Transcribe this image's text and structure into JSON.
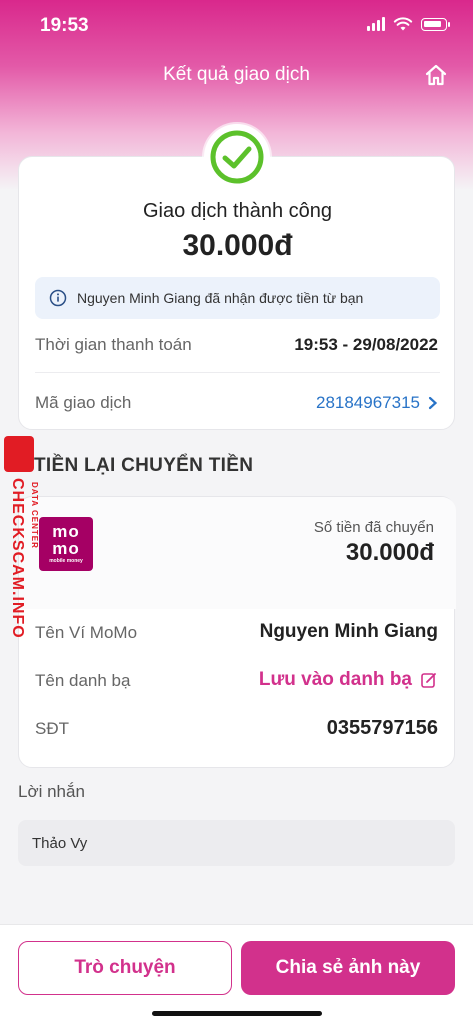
{
  "status_bar": {
    "time": "19:53"
  },
  "header": {
    "title": "Kết quả giao dịch"
  },
  "result": {
    "status": "Giao dịch thành công",
    "amount": "30.000đ",
    "info": "Nguyen Minh Giang đã nhận được tiền từ bạn",
    "rows": [
      {
        "label": "Thời gian thanh toán",
        "value": "19:53 - 29/08/2022"
      },
      {
        "label": "Mã giao dịch",
        "value": "28184967315"
      }
    ]
  },
  "transfer": {
    "section_title": "TIỀN LẠI CHUYỂN TIỀN",
    "logo": {
      "line1": "mo",
      "line2": "mo",
      "line3": "mobile money"
    },
    "sent_label": "Số tiền đã chuyển",
    "sent_amount": "30.000đ",
    "rows": [
      {
        "label": "Tên Ví MoMo",
        "value": "Nguyen Minh Giang"
      },
      {
        "label": "Tên danh bạ",
        "value": "Lưu vào danh bạ"
      },
      {
        "label": "SĐT",
        "value": "0355797156"
      }
    ]
  },
  "message": {
    "label": "Lời nhắn",
    "value": "Thảo Vy"
  },
  "actions": {
    "chat": "Trò chuyện",
    "share": "Chia sẻ ảnh này"
  },
  "watermark": {
    "text": "CHECKSCAM.INFO",
    "sub": "DATA CENTER"
  },
  "colors": {
    "brand": "#d2318c",
    "success": "#5cc12b",
    "link": "#2873c7"
  }
}
